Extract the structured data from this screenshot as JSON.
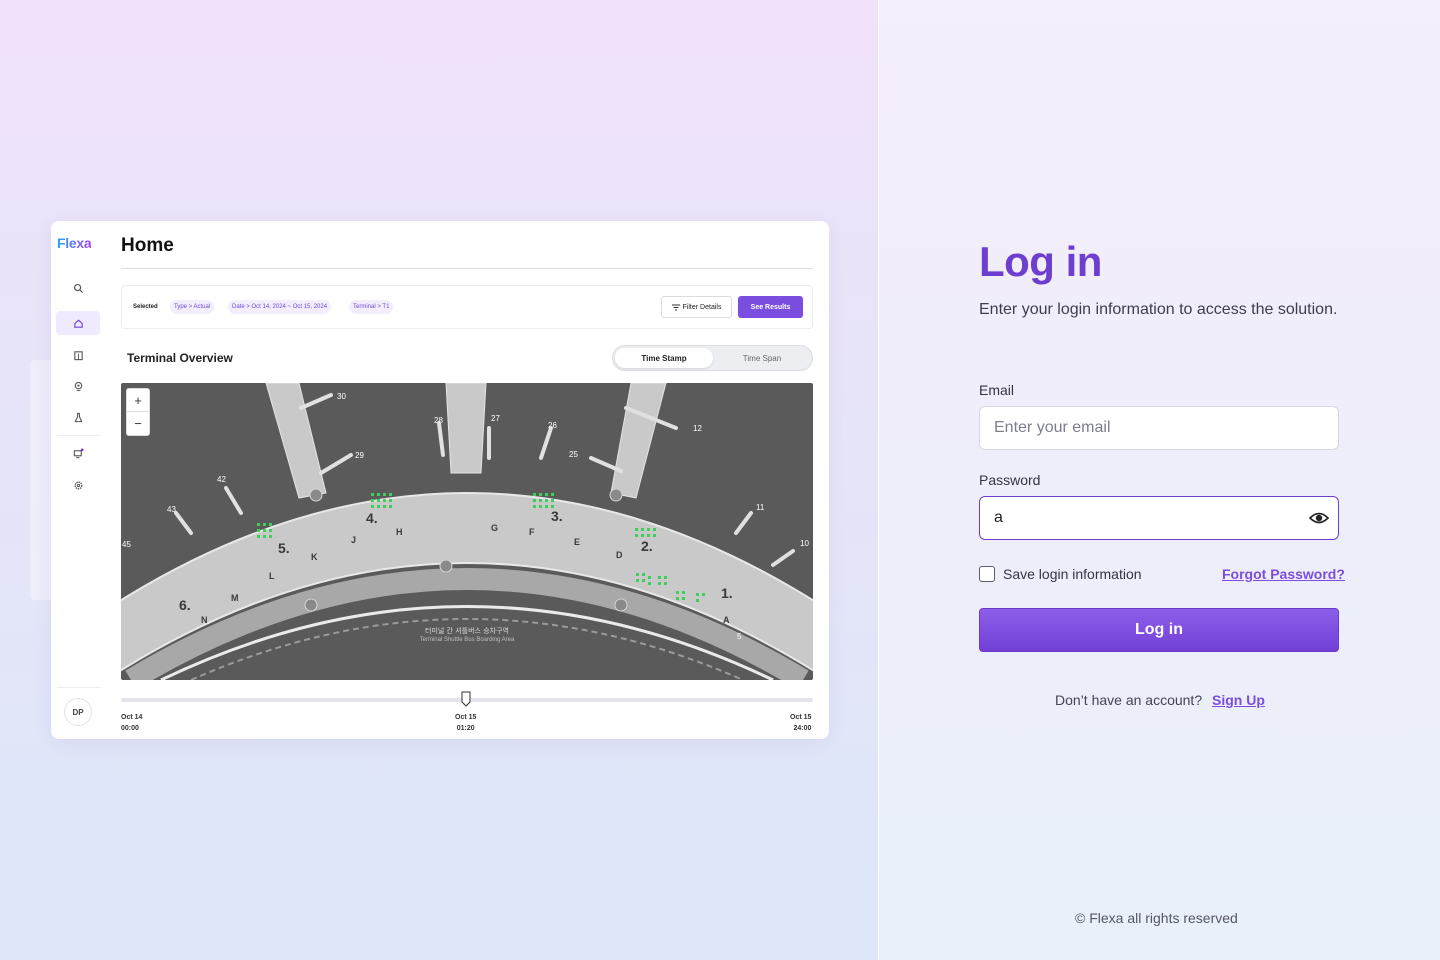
{
  "preview": {
    "logo": "Flexa",
    "page_title": "Home",
    "filter": {
      "selected_label": "Selected",
      "chips": [
        "Type > Actual",
        "Date > Oct 14, 2024 ~ Oct 15, 2024",
        "Terminal > T1"
      ],
      "filter_details_label": "Filter Details",
      "see_results_label": "See Results"
    },
    "section_title": "Terminal Overview",
    "toggle": {
      "option_1": "Time Stamp",
      "option_2": "Time Span"
    },
    "map": {
      "gate_numbers": [
        "30",
        "28",
        "27",
        "26",
        "25",
        "12",
        "29",
        "42",
        "43",
        "45",
        "11",
        "10",
        "5"
      ],
      "concourse_numbers": [
        "5.",
        "4.",
        "3.",
        "2.",
        "1.",
        "6."
      ],
      "check_in_letters": [
        "K",
        "J",
        "H",
        "G",
        "F",
        "E",
        "D",
        "L",
        "M",
        "N",
        "A"
      ],
      "bus_area_kr": "터미널 간 셔틀버스 승차구역",
      "bus_area_en": "Terminal Shuttle Bus Boarding Area",
      "zoom_in": "+",
      "zoom_out": "−"
    },
    "timeline": {
      "start_date": "Oct 14",
      "start_time": "00:00",
      "current_date": "Oct 15",
      "current_time": "01:20",
      "end_date": "Oct 15",
      "end_time": "24:00"
    },
    "avatar_initials": "DP"
  },
  "login": {
    "title": "Log in",
    "subtitle": "Enter your login information to access the solution.",
    "email_label": "Email",
    "email_placeholder": "Enter your email",
    "email_value": "",
    "password_label": "Password",
    "password_value": "a",
    "save_login_label": "Save login information",
    "save_login_checked": false,
    "forgot_label": "Forgot Password?",
    "login_button": "Log in",
    "signup_prompt": "Don’t have an account?",
    "signup_link": "Sign Up"
  },
  "footer": "© Flexa all rights reserved",
  "colors": {
    "brand_purple": "#6d3fcf",
    "button_purple": "#7b4ee0",
    "seat_green": "#3ecf5a"
  }
}
